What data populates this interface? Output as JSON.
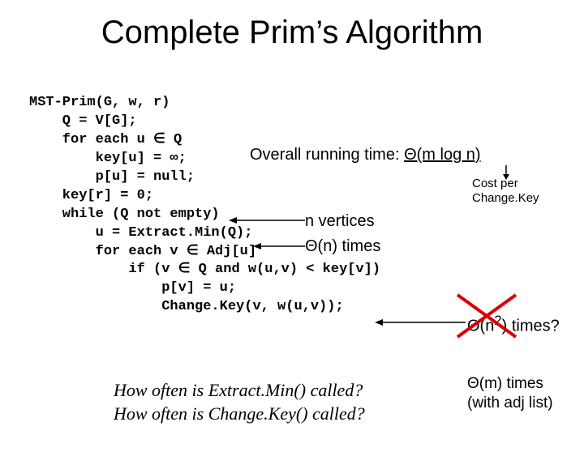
{
  "title": "Complete Prim’s Algorithm",
  "code": "MST-Prim(G, w, r)\n    Q = V[G];\n    for each u ∈ Q\n        key[u] = ∞;\n        p[u] = null;\n    key[r] = 0;\n    while (Q not empty)\n        u = Extract.Min(Q);\n        for each v ∈ Adj[u]\n            if (v ∈ Q and w(u,v) < key[v])\n                p[v] = u;\n                Change.Key(v, w(u,v));",
  "overall_prefix": "Overall running time: ",
  "overall_theta": "Θ(m log n)",
  "cost_per_line1": "Cost per",
  "cost_per_line2": "Change.Key",
  "n_vertices": "n vertices",
  "theta_n_times": "Θ(n) times",
  "theta_n2_prefix": "Θ(n",
  "theta_n2_exp": "2",
  "theta_n2_suffix": ") times?",
  "q1": "How often is Extract.Min() called?",
  "q2": "How often is Change.Key() called?",
  "a1": "Θ(m) times",
  "a2": "(with adj list)"
}
